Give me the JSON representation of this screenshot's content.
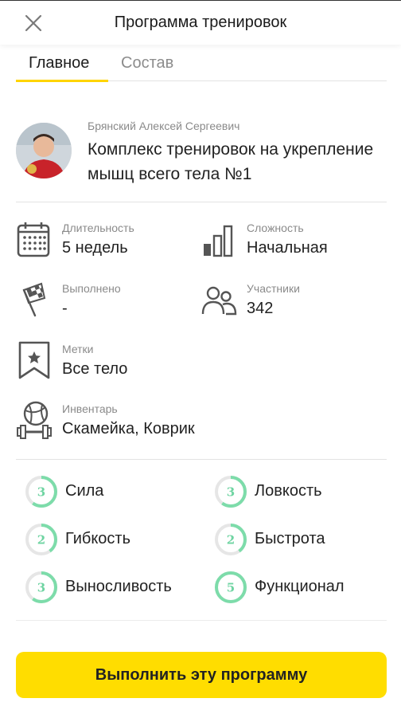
{
  "header": {
    "title": "Программа тренировок",
    "close_icon": "close-icon"
  },
  "tabs": [
    {
      "label": "Главное",
      "active": true
    },
    {
      "label": "Состав",
      "active": false
    }
  ],
  "author": {
    "name": "Брянский Алексей Сергеевич",
    "avatar_icon": "avatar"
  },
  "program": {
    "title": "Комплекс тренировок на укрепление мышц всего тела №1"
  },
  "info": {
    "duration": {
      "label": "Длительность",
      "value": "5 недель",
      "icon": "calendar-icon"
    },
    "difficulty": {
      "label": "Сложность",
      "value": "Начальная",
      "icon": "bar-chart-icon"
    },
    "completed": {
      "label": "Выполнено",
      "value": "-",
      "icon": "checkered-flag-icon"
    },
    "participants": {
      "label": "Участники",
      "value": "342",
      "icon": "people-icon"
    },
    "tags": {
      "label": "Метки",
      "value": "Все тело",
      "icon": "bookmark-star-icon"
    },
    "equipment": {
      "label": "Инвентарь",
      "value": "Скамейка, Коврик",
      "icon": "ball-dumbbell-icon"
    }
  },
  "skills": [
    {
      "label": "Сила",
      "level": "3",
      "max": 5
    },
    {
      "label": "Ловкость",
      "level": "3",
      "max": 5
    },
    {
      "label": "Гибкость",
      "level": "2",
      "max": 5
    },
    {
      "label": "Быстрота",
      "level": "2",
      "max": 5
    },
    {
      "label": "Выносливость",
      "level": "3",
      "max": 5
    },
    {
      "label": "Функционал",
      "level": "5",
      "max": 5
    }
  ],
  "colors": {
    "accent": "#ffdd00",
    "tab_underline": "#ffd400",
    "ring_fill": "#7ddcaa",
    "ring_track": "#e6e6e6"
  },
  "cta": {
    "label": "Выполнить эту программу"
  }
}
